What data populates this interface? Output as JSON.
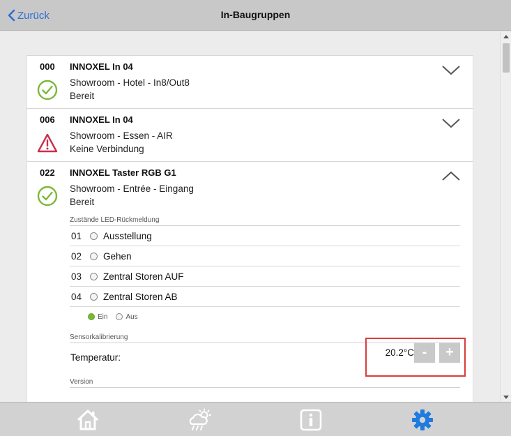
{
  "header": {
    "back_label": "Zurück",
    "title": "In-Baugruppen"
  },
  "modules": [
    {
      "number": "000",
      "name": "INNOXEL In 04",
      "location": "Showroom - Hotel - In8/Out8",
      "status": "Bereit",
      "status_icon": "check-circle-icon",
      "expanded": false
    },
    {
      "number": "006",
      "name": "INNOXEL In 04",
      "location": "Showroom - Essen - AIR",
      "status": "Keine Verbindung",
      "status_icon": "warning-triangle-icon",
      "expanded": false
    },
    {
      "number": "022",
      "name": "INNOXEL Taster RGB G1",
      "location": "Showroom - Entrée - Eingang",
      "status": "Bereit",
      "status_icon": "check-circle-icon",
      "expanded": true
    }
  ],
  "detail": {
    "led_section_title": "Zustände LED-Rückmeldung",
    "leds": [
      {
        "index": "01",
        "label": "Ausstellung",
        "on": false
      },
      {
        "index": "02",
        "label": "Gehen",
        "on": false
      },
      {
        "index": "03",
        "label": "Zentral Storen AUF",
        "on": false
      },
      {
        "index": "04",
        "label": "Zentral Storen AB",
        "on": false
      }
    ],
    "legend_on": "Ein",
    "legend_off": "Aus",
    "sensor_section_title": "Sensorkalibrierung",
    "temperature_label": "Temperatur:",
    "temperature_value": "20.2°C",
    "minus_label": "-",
    "plus_label": "+",
    "version_section_title": "Version"
  },
  "footer": {
    "tabs": [
      "home-icon",
      "weather-icon",
      "info-icon",
      "settings-icon"
    ],
    "active_tab": "settings-icon"
  },
  "colors": {
    "accent": "#2f6fd2",
    "ok": "#7cb83a",
    "warning": "#c8304a",
    "highlight": "#d93d3d"
  }
}
